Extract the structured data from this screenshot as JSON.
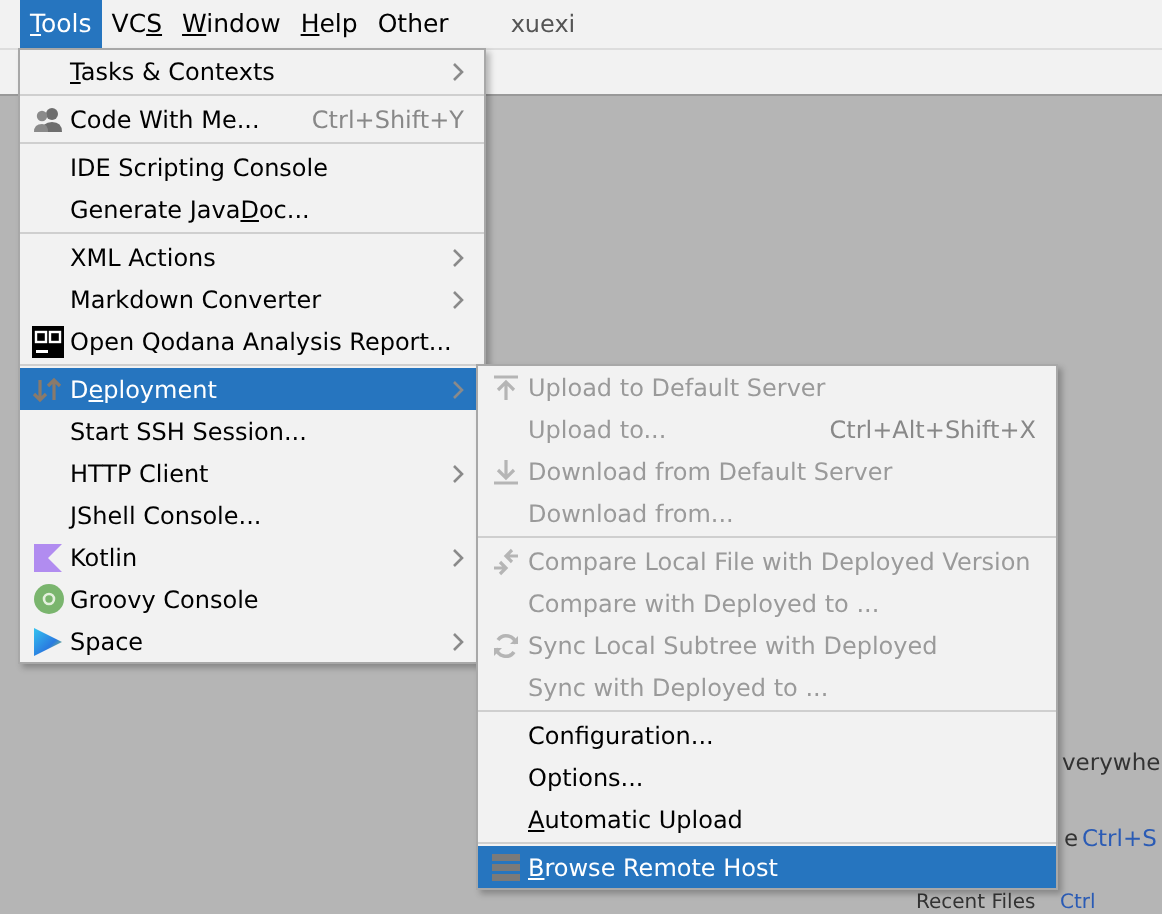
{
  "menubar": [
    {
      "key": "T",
      "post": "ools",
      "selected": true
    },
    {
      "pre": "VC",
      "key": "S",
      "selected": false
    },
    {
      "key": "W",
      "post": "indow",
      "selected": false
    },
    {
      "key": "H",
      "post": "elp",
      "selected": false
    },
    {
      "pre": "Other",
      "selected": false
    }
  ],
  "project": "xuexi",
  "background_hints": [
    {
      "text": "verywhe",
      "kind": "plain"
    },
    {
      "text": "e",
      "kind": "plain"
    },
    {
      "text": "Ctrl+S",
      "kind": "shortcut"
    },
    {
      "text": "Recent Files",
      "kind": "plain"
    },
    {
      "text": "Ctrl",
      "kind": "shortcut"
    }
  ],
  "tools_menu": [
    {
      "kind": "item",
      "key": "T",
      "post": "asks & Contexts",
      "submenu": true,
      "selected": false
    },
    {
      "kind": "separator"
    },
    {
      "kind": "item",
      "pre": "Code With Me...",
      "shortcut": "Ctrl+Shift+Y",
      "selected": false
    },
    {
      "kind": "separator"
    },
    {
      "kind": "item",
      "pre": "IDE Scripting Console",
      "selected": false
    },
    {
      "kind": "item",
      "pre": "Generate Java",
      "key": "D",
      "post": "oc...",
      "selected": false
    },
    {
      "kind": "separator"
    },
    {
      "kind": "item",
      "pre": "XML Actions",
      "submenu": true,
      "selected": false
    },
    {
      "kind": "item",
      "pre": "Markdown Converter",
      "submenu": true,
      "selected": false
    },
    {
      "kind": "item",
      "pre": "Open Qodana Analysis Report...",
      "selected": false
    },
    {
      "kind": "separator"
    },
    {
      "kind": "item",
      "pre": "D",
      "key": "e",
      "post": "ployment",
      "submenu": true,
      "selected": true
    },
    {
      "kind": "item",
      "pre": "Start SSH Session...",
      "selected": false
    },
    {
      "kind": "item",
      "pre": "HTTP Client",
      "submenu": true,
      "selected": false
    },
    {
      "kind": "item",
      "pre": "JShell Console...",
      "selected": false
    },
    {
      "kind": "item",
      "pre": "Kotlin",
      "submenu": true,
      "selected": false
    },
    {
      "kind": "item",
      "pre": "Groovy Console",
      "selected": false
    },
    {
      "kind": "item",
      "pre": "Space",
      "submenu": true,
      "selected": false
    }
  ],
  "deployment_menu": [
    {
      "kind": "item",
      "pre": "Upload to Default Server",
      "disabled": true,
      "selected": false
    },
    {
      "kind": "item",
      "pre": "Upload to...",
      "shortcut": "Ctrl+Alt+Shift+X",
      "disabled": true,
      "selected": false
    },
    {
      "kind": "item",
      "pre": "Download from Default Server",
      "disabled": true,
      "selected": false
    },
    {
      "kind": "item",
      "pre": "Download from...",
      "disabled": true,
      "selected": false
    },
    {
      "kind": "separator"
    },
    {
      "kind": "item",
      "pre": "Compare Local File with Deployed Version",
      "disabled": true,
      "selected": false
    },
    {
      "kind": "item",
      "pre": "Compare with Deployed to ...",
      "disabled": true,
      "selected": false
    },
    {
      "kind": "item",
      "pre": "Sync Local Subtree with Deployed",
      "disabled": true,
      "selected": false
    },
    {
      "kind": "item",
      "pre": "Sync with Deployed to ...",
      "disabled": true,
      "selected": false
    },
    {
      "kind": "separator"
    },
    {
      "kind": "item",
      "pre": "Configuration...",
      "disabled": false,
      "selected": false
    },
    {
      "kind": "item",
      "pre": "Options...",
      "disabled": false,
      "selected": false
    },
    {
      "kind": "item",
      "key": "A",
      "post": "utomatic Upload",
      "disabled": false,
      "selected": false
    },
    {
      "kind": "separator"
    },
    {
      "kind": "item",
      "key": "B",
      "post": "rowse Remote Host",
      "disabled": false,
      "selected": true
    }
  ]
}
